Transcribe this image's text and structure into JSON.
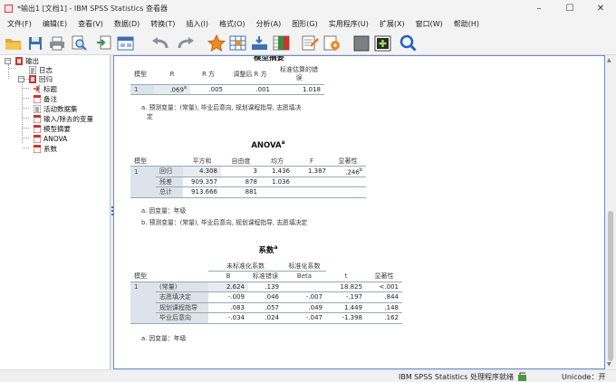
{
  "window": {
    "title": "*输出1 [文档1] - IBM SPSS Statistics 查看器",
    "min": "–",
    "max": "☐",
    "close": "✕"
  },
  "menu": [
    "文件(F)",
    "编辑(E)",
    "查看(V)",
    "数据(D)",
    "转换(T)",
    "插入(I)",
    "格式(O)",
    "分析(A)",
    "图形(G)",
    "实用程序(U)",
    "扩展(X)",
    "窗口(W)",
    "帮助(H)"
  ],
  "toolbar_icons": [
    "open-folder-icon",
    "save-icon",
    "print-icon",
    "print-preview-icon",
    "export-icon",
    "dialog-recall-icon",
    "undo-icon",
    "redo-icon",
    "goto-data-icon",
    "goto-case-icon",
    "goto-variable-icon",
    "variables-icon",
    "insert-output-icon",
    "insert-chart-icon",
    "gray-box-icon",
    "add-icon",
    "search-icon"
  ],
  "tree": {
    "root": "输出",
    "log": "日志",
    "regression": "回归",
    "items": [
      "标题",
      "备注",
      "活动数据集",
      "输入/除去的变量",
      "模型摘要",
      "ANOVA",
      "系数"
    ]
  },
  "model_summary": {
    "title_partial": "模型摘要",
    "headers": [
      "模型",
      "R",
      "R 方",
      "调整后 R 方",
      "标准估算的错\n误"
    ],
    "row": {
      "model": "1",
      "r": ".069",
      "r_sup": "a",
      "r2": ".005",
      "adj_r2": ".001",
      "se": "1.018"
    },
    "note_a": "a. 预测变量：(常量), 毕业后意向, 规划课程指导, 志愿填决",
    "note_a2": "定"
  },
  "anova": {
    "title": "ANOVA",
    "title_sup": "a",
    "headers": [
      "模型",
      "",
      "平方和",
      "自由度",
      "均方",
      "F",
      "显著性"
    ],
    "rows": [
      {
        "model": "1",
        "label": "回归",
        "ss": "4.308",
        "df": "3",
        "ms": "1.436",
        "f": "1.387",
        "sig": ".246",
        "sig_sup": "b"
      },
      {
        "model": "",
        "label": "残差",
        "ss": "909.357",
        "df": "878",
        "ms": "1.036",
        "f": "",
        "sig": ""
      },
      {
        "model": "",
        "label": "总计",
        "ss": "913.666",
        "df": "881",
        "ms": "",
        "f": "",
        "sig": ""
      }
    ],
    "note_a": "a. 因变量：年级",
    "note_b": "b. 预测变量：(常量), 毕业后意向, 规划课程指导, 志愿填决定"
  },
  "coef": {
    "title": "系数",
    "title_sup": "a",
    "group_unstd": "未标准化系数",
    "group_std": "标准化系数",
    "headers": [
      "模型",
      "",
      "B",
      "标准错误",
      "Beta",
      "t",
      "显著性"
    ],
    "rows": [
      {
        "model": "1",
        "label": "(常量)",
        "b": "2.624",
        "se": ".139",
        "beta": "",
        "t": "18.825",
        "sig": "<.001"
      },
      {
        "model": "",
        "label": "志愿填决定",
        "b": "-.009",
        "se": ".046",
        "beta": "-.007",
        "t": "-.197",
        "sig": ".844"
      },
      {
        "model": "",
        "label": "规划课程指导",
        "b": ".083",
        "se": ".057",
        "beta": ".049",
        "t": "1.449",
        "sig": ".148"
      },
      {
        "model": "",
        "label": "毕业后意向",
        "b": "-.034",
        "se": ".024",
        "beta": "-.047",
        "t": "-1.398",
        "sig": ".162"
      }
    ],
    "note_a": "a. 因变量：年级"
  },
  "status": {
    "processor": "IBM SPSS Statistics 处理程序就绪",
    "unicode": "Unicode：开"
  }
}
